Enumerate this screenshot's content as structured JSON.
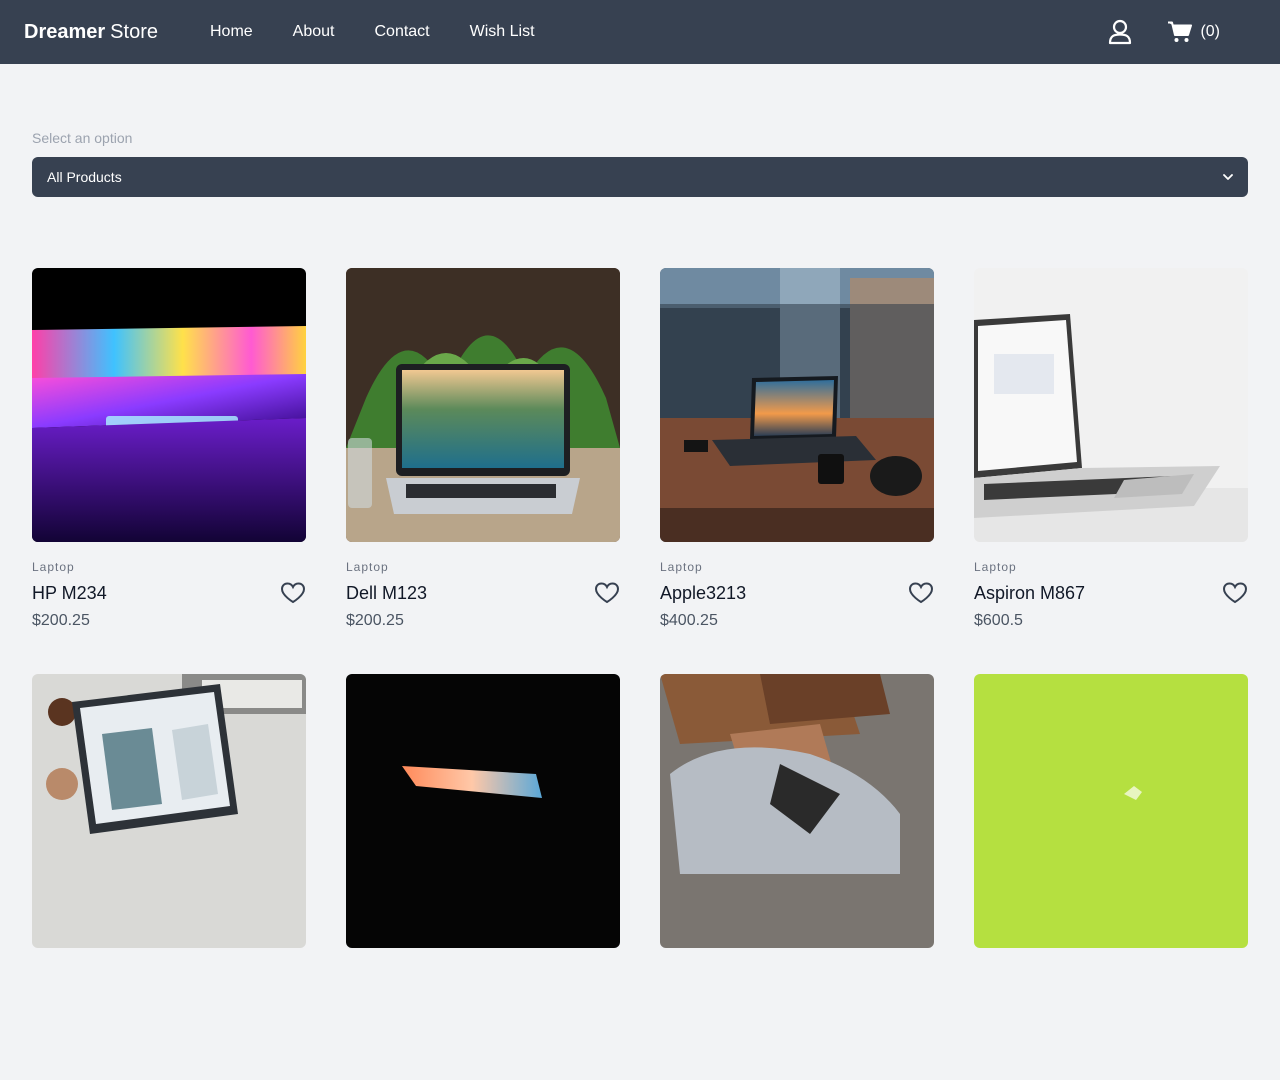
{
  "brand": {
    "bold": "Dreamer",
    "rest": "Store"
  },
  "nav": {
    "links": [
      "Home",
      "About",
      "Contact",
      "Wish List"
    ],
    "user_icon": "user-icon",
    "cart_icon": "cart-icon",
    "cart_count": "(0)"
  },
  "filter": {
    "label": "Select an option",
    "selected": "All Products"
  },
  "products": [
    {
      "category": "Laptop",
      "title": "HP M234",
      "price": "$200.25"
    },
    {
      "category": "Laptop",
      "title": "Dell M123",
      "price": "$200.25"
    },
    {
      "category": "Laptop",
      "title": "Apple3213",
      "price": "$400.25"
    },
    {
      "category": "Laptop",
      "title": "Aspiron M867",
      "price": "$600.5"
    },
    {
      "category": "",
      "title": "",
      "price": ""
    },
    {
      "category": "",
      "title": "",
      "price": ""
    },
    {
      "category": "",
      "title": "",
      "price": ""
    },
    {
      "category": "",
      "title": "",
      "price": ""
    }
  ],
  "colors": {
    "navbar": "#374151",
    "background": "#f2f3f5",
    "select": "#374151"
  }
}
